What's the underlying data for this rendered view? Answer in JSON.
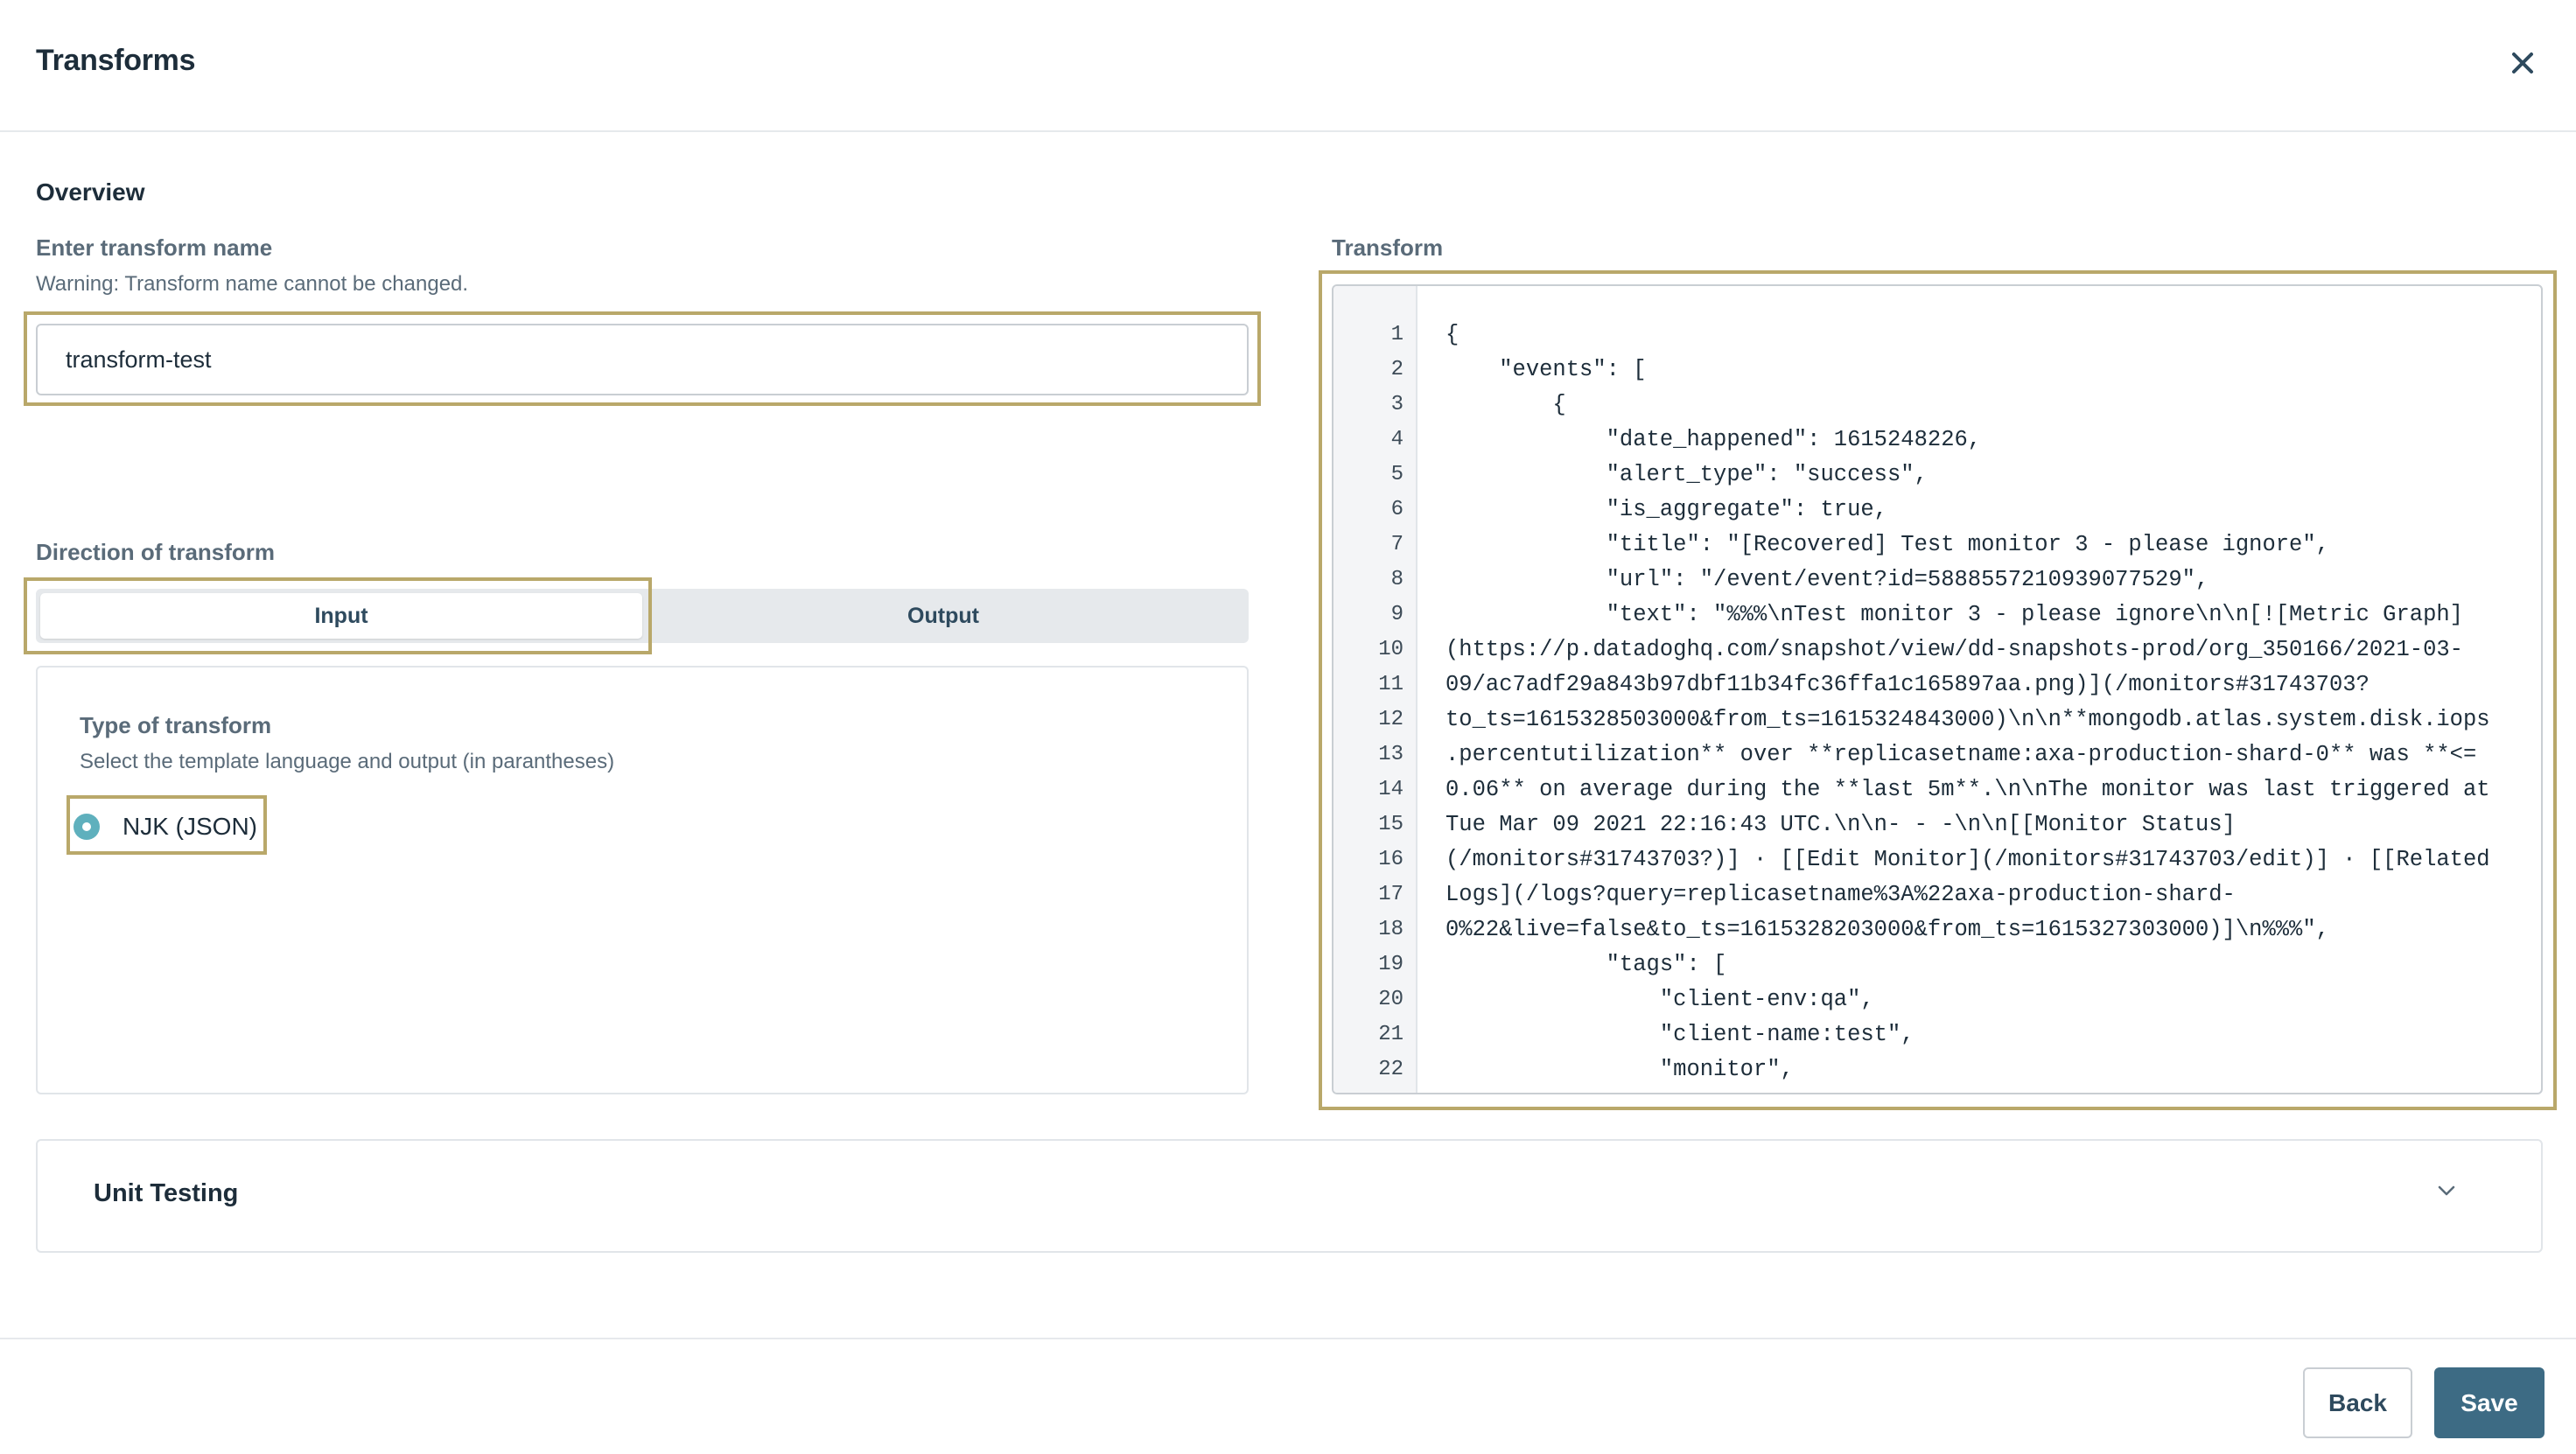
{
  "window": {
    "title": "Transforms"
  },
  "overview": {
    "heading": "Overview",
    "name_label": "Enter transform name",
    "name_warning": "Warning: Transform name cannot be changed.",
    "name_value": "transform-test"
  },
  "direction": {
    "label": "Direction of transform",
    "options": [
      {
        "label": "Input",
        "selected": true
      },
      {
        "label": "Output",
        "selected": false
      }
    ]
  },
  "type": {
    "label": "Type of transform",
    "helper": "Select the template language and output (in parantheses)",
    "option_label": "NJK (JSON)",
    "option_selected": true
  },
  "transform": {
    "label": "Transform",
    "line_numbers": [
      "1",
      "2",
      "3",
      "4",
      "5",
      "6",
      "7",
      "8",
      "9",
      "10",
      "11",
      "12",
      "13",
      "14",
      "15",
      "16",
      "17",
      "18",
      "19",
      "20",
      "21",
      "22"
    ],
    "code_lines": [
      "{",
      "    \"events\": [",
      "        {",
      "            \"date_happened\": 1615248226,",
      "            \"alert_type\": \"success\",",
      "            \"is_aggregate\": true,",
      "            \"title\": \"[Recovered] Test monitor 3 - please ignore\",",
      "            \"url\": \"/event/event?id=5888557210939077529\",",
      "            \"text\": \"%%%\\nTest monitor 3 - please ignore\\n\\n[![Metric Graph]",
      "(https://p.datadoghq.com/snapshot/view/dd-snapshots-prod/org_350166/2021-03-",
      "09/ac7adf29a843b97dbf11b34fc36ffa1c165897aa.png)](/monitors#31743703?",
      "to_ts=1615328503000&from_ts=1615324843000)\\n\\n**mongodb.atlas.system.disk.iops",
      ".percentutilization** over **replicasetname:axa-production-shard-0** was **<=",
      "0.06** on average during the **last 5m**.\\n\\nThe monitor was last triggered at",
      "Tue Mar 09 2021 22:16:43 UTC.\\n\\n- - -\\n\\n[[Monitor Status]",
      "(/monitors#31743703?)] · [[Edit Monitor](/monitors#31743703/edit)] · [[Related",
      "Logs](/logs?query=replicasetname%3A%22axa-production-shard-",
      "0%22&live=false&to_ts=1615328203000&from_ts=1615327303000)]\\n%%%\",",
      "            \"tags\": [",
      "                \"client-env:qa\",",
      "                \"client-name:test\",",
      "                \"monitor\","
    ]
  },
  "unit_testing": {
    "label": "Unit Testing"
  },
  "footer": {
    "back_label": "Back",
    "save_label": "Save"
  },
  "icons": {
    "close": "close-icon",
    "chevron": "chevron-down-icon"
  },
  "colors": {
    "accent": "#3d6b84",
    "radio": "#5fb0bd",
    "highlight": "#b9a86a"
  }
}
